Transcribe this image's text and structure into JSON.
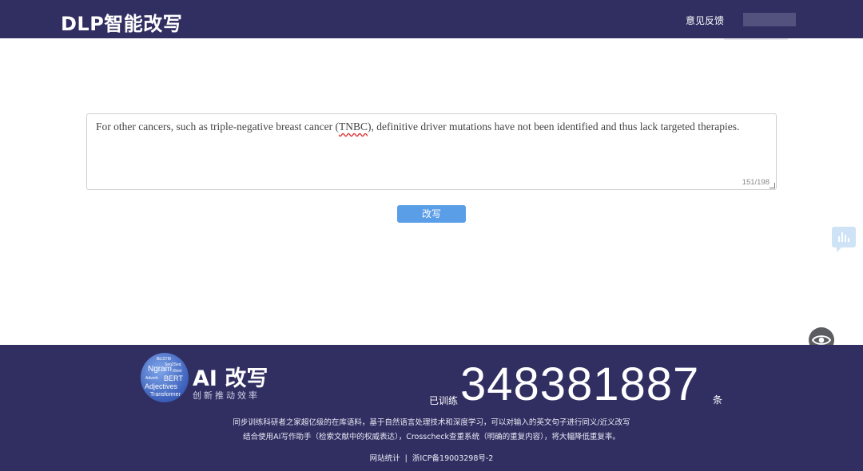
{
  "header": {
    "brand": "DLP智能改写",
    "feedback_label": "意见反馈"
  },
  "editor": {
    "text_before": "For other cancers, such as triple-negative breast cancer (",
    "text_abbr": "TNBC",
    "text_after": "), definitive driver mutations have not been identified and thus lack targeted therapies.",
    "char_count": "151/198"
  },
  "actions": {
    "rewrite_label": "改写"
  },
  "footer": {
    "logo_words": [
      "BiLSTM",
      "Seq2Seq",
      "Ngram",
      "Xlnet",
      "BERT",
      "Adverb",
      "Adjectives",
      "Transformer"
    ],
    "ai_title": "AI 改写",
    "ai_subtitle": "创新推动效率",
    "trained_prefix": "已训练",
    "trained_count": "348381887",
    "trained_suffix": "条",
    "description_line1": "同步训练科研者之家超亿级的在库语料，基于自然语言处理技术和深度学习，可以对输入的英文句子进行同义/近义改写",
    "description_line2": "结合使用AI写作助手（检索文献中的权威表达），Crosscheck查重系统（明确的重复内容），将大幅降低重复率。",
    "link_stats": "网站统计",
    "link_separator": "|",
    "link_icp": "浙ICP备19003298号-2"
  },
  "colors": {
    "header_bg": "#312f62",
    "button_bg": "#5b9ee8",
    "footer_bg": "#312f62"
  }
}
